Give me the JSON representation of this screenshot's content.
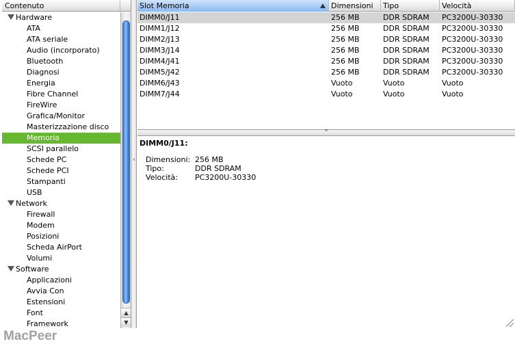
{
  "sidebar": {
    "header": "Contenuto",
    "rows": [
      {
        "kind": "category",
        "label": "Hardware"
      },
      {
        "kind": "item",
        "label": "ATA"
      },
      {
        "kind": "item",
        "label": "ATA seriale"
      },
      {
        "kind": "item",
        "label": "Audio (incorporato)"
      },
      {
        "kind": "item",
        "label": "Bluetooth"
      },
      {
        "kind": "item",
        "label": "Diagnosi"
      },
      {
        "kind": "item",
        "label": "Energia"
      },
      {
        "kind": "item",
        "label": "Fibre Channel"
      },
      {
        "kind": "item",
        "label": "FireWire"
      },
      {
        "kind": "item",
        "label": "Grafica/Monitor"
      },
      {
        "kind": "item",
        "label": "Masterizzazione disco"
      },
      {
        "kind": "item",
        "label": "Memoria",
        "selected": true
      },
      {
        "kind": "item",
        "label": "SCSI parallelo"
      },
      {
        "kind": "item",
        "label": "Schede PC"
      },
      {
        "kind": "item",
        "label": "Schede PCI"
      },
      {
        "kind": "item",
        "label": "Stampanti"
      },
      {
        "kind": "item",
        "label": "USB"
      },
      {
        "kind": "category",
        "label": "Network"
      },
      {
        "kind": "item",
        "label": "Firewall"
      },
      {
        "kind": "item",
        "label": "Modem"
      },
      {
        "kind": "item",
        "label": "Posizioni"
      },
      {
        "kind": "item",
        "label": "Scheda AirPort"
      },
      {
        "kind": "item",
        "label": "Volumi"
      },
      {
        "kind": "category",
        "label": "Software"
      },
      {
        "kind": "item",
        "label": "Applicazioni"
      },
      {
        "kind": "item",
        "label": "Avvia Con"
      },
      {
        "kind": "item",
        "label": "Estensioni"
      },
      {
        "kind": "item",
        "label": "Font"
      },
      {
        "kind": "item",
        "label": "Framework"
      }
    ]
  },
  "table": {
    "columns": [
      "Slot Memoria",
      "Dimensioni",
      "Tipo",
      "Velocità"
    ],
    "sorted_column": 0,
    "rows": [
      {
        "cells": [
          "DIMM0/J11",
          "256 MB",
          "DDR SDRAM",
          "PC3200U-30330"
        ],
        "selected": true
      },
      {
        "cells": [
          "DIMM1/J12",
          "256 MB",
          "DDR SDRAM",
          "PC3200U-30330"
        ]
      },
      {
        "cells": [
          "DIMM2/J13",
          "256 MB",
          "DDR SDRAM",
          "PC3200U-30330"
        ]
      },
      {
        "cells": [
          "DIMM3/J14",
          "256 MB",
          "DDR SDRAM",
          "PC3200U-30330"
        ]
      },
      {
        "cells": [
          "DIMM4/J41",
          "256 MB",
          "DDR SDRAM",
          "PC3200U-30330"
        ]
      },
      {
        "cells": [
          "DIMM5/J42",
          "256 MB",
          "DDR SDRAM",
          "PC3200U-30330"
        ]
      },
      {
        "cells": [
          "DIMM6/J43",
          "Vuoto",
          "Vuoto",
          "Vuoto"
        ]
      },
      {
        "cells": [
          "DIMM7/J44",
          "Vuoto",
          "Vuoto",
          "Vuoto"
        ]
      }
    ]
  },
  "detail": {
    "title": "DIMM0/J11:",
    "fields": [
      {
        "label": "Dimensioni:",
        "value": "256 MB"
      },
      {
        "label": "Tipo:",
        "value": "DDR SDRAM"
      },
      {
        "label": "Velocità:",
        "value": "PC3200U-30330"
      }
    ]
  },
  "watermark": "MacPeer",
  "colors": {
    "selection_sidebar": "#66b830",
    "selection_table": "#d4d4d4",
    "scrollbar_thumb": "#4f8ee6",
    "watermark": "#a0a0a0"
  },
  "icons": {
    "disclosure": "disclosure-triangle-icon",
    "sort": "sort-ascending-icon",
    "scroll_up": "scroll-up-arrow-icon",
    "scroll_down": "scroll-down-arrow-icon",
    "split": "split-handle-icon",
    "resize": "resize-grip-icon"
  }
}
